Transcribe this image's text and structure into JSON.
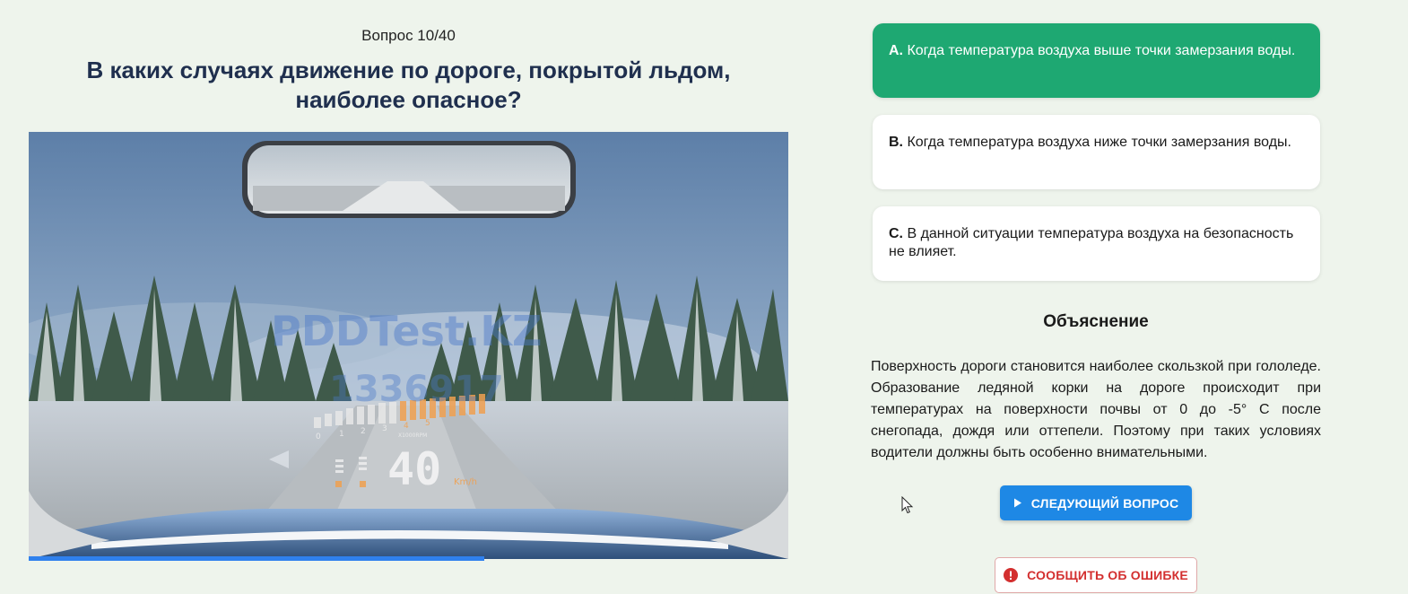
{
  "quiz": {
    "counter": "Вопрос 10/40",
    "question": "В каких случаях движение по дороге, покрытой льдом, наиболее опасное?",
    "progress_fraction": 0.6
  },
  "media": {
    "watermark_line1": "PDDTest.KZ",
    "watermark_line2": "1336917",
    "speed": "40",
    "speed_unit": "Km/h",
    "rpm_label": "X1000RPM",
    "rpm_ticks": [
      "0",
      "1",
      "2",
      "3",
      "4",
      "5"
    ]
  },
  "answers": [
    {
      "letter": "A.",
      "text": "Когда температура воздуха выше точки замерзания воды.",
      "state": "correct"
    },
    {
      "letter": "B.",
      "text": "Когда температура воздуха ниже точки замерзания воды.",
      "state": "default"
    },
    {
      "letter": "C.",
      "text": "В данной ситуации температура воздуха на безопасность не влияет.",
      "state": "default"
    }
  ],
  "explanation": {
    "title": "Объяснение",
    "text": "Поверхность дороги становится наиболее скользкой при гололеде. Образование ледяной корки на дороге происходит при температурах на поверхности почвы от 0 до -5° С после снегопада, дождя или оттепели. Поэтому при таких условиях водители должны быть особенно внимательными."
  },
  "buttons": {
    "next_label": "СЛЕДУЮЩИЙ ВОПРОС",
    "report_label": "СООБЩИТЬ ОБ ОШИБКЕ"
  },
  "colors": {
    "correct": "#1ea872",
    "primary": "#1e88e5",
    "danger": "#d32f2f",
    "background": "#eef4ec"
  },
  "icons": {
    "next": "play-icon",
    "report": "alert-circle-icon"
  }
}
